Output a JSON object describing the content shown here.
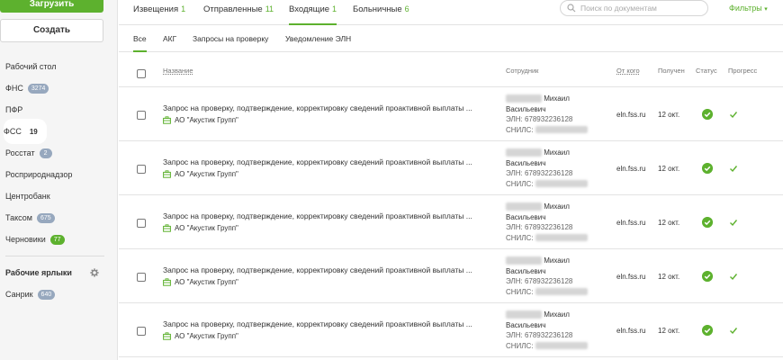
{
  "sidebar": {
    "upload_label": "Загрузить",
    "create_label": "Создать",
    "items": [
      {
        "label": "Рабочий стол",
        "badge": ""
      },
      {
        "label": "ФНС",
        "badge": "3274"
      },
      {
        "label": "ПФР",
        "badge": ""
      },
      {
        "label": "ФСС",
        "badge": "19"
      },
      {
        "label": "Росстат",
        "badge": "2"
      },
      {
        "label": "Росприроднадзор",
        "badge": ""
      },
      {
        "label": "Центробанк",
        "badge": ""
      },
      {
        "label": "Таксом",
        "badge": "675"
      },
      {
        "label": "Черновики",
        "badge": "77"
      }
    ],
    "labels_title": "Рабочие ярлыки",
    "labels": [
      {
        "label": "Санрик",
        "badge": "640"
      }
    ]
  },
  "topbar": {
    "tabs": [
      {
        "label": "Извещения",
        "count": "1"
      },
      {
        "label": "Отправленные",
        "count": "11"
      },
      {
        "label": "Входящие",
        "count": "1"
      },
      {
        "label": "Больничные",
        "count": "6"
      }
    ],
    "search_placeholder": "Поиск по документам",
    "filters_label": "Фильтры"
  },
  "subtabs": [
    "Все",
    "АКГ",
    "Запросы на проверку",
    "Уведомление ЭЛН"
  ],
  "table": {
    "headers": {
      "name": "Название",
      "employee": "Сотрудник",
      "from": "От кого",
      "received": "Получен",
      "status": "Статус",
      "progress": "Прогресс"
    },
    "rows": [
      {
        "title": "Запрос на проверку, подтверждение, корректировку сведений проактивной выплаты ...",
        "org": "АО \"Акустик Групп\"",
        "emp_name": "Михаил",
        "emp_patronymic": "Васильевич",
        "eln": "ЭЛН: 678932236128",
        "snils": "СНИЛС:",
        "from": "eln.fss.ru",
        "date": "12 окт."
      },
      {
        "title": "Запрос на проверку, подтверждение, корректировку сведений проактивной выплаты ...",
        "org": "АО \"Акустик Групп\"",
        "emp_name": "Михаил",
        "emp_patronymic": "Васильевич",
        "eln": "ЭЛН: 678932236128",
        "snils": "СНИЛС:",
        "from": "eln.fss.ru",
        "date": "12 окт."
      },
      {
        "title": "Запрос на проверку, подтверждение, корректировку сведений проактивной выплаты ...",
        "org": "АО \"Акустик Групп\"",
        "emp_name": "Михаил",
        "emp_patronymic": "Васильевич",
        "eln": "ЭЛН: 678932236128",
        "snils": "СНИЛС:",
        "from": "eln.fss.ru",
        "date": "12 окт."
      },
      {
        "title": "Запрос на проверку, подтверждение, корректировку сведений проактивной выплаты ...",
        "org": "АО \"Акустик Групп\"",
        "emp_name": "Михаил",
        "emp_patronymic": "Васильевич",
        "eln": "ЭЛН: 678932236128",
        "snils": "СНИЛС:",
        "from": "eln.fss.ru",
        "date": "12 окт."
      },
      {
        "title": "Запрос на проверку, подтверждение, корректировку сведений проактивной выплаты ...",
        "org": "АО \"Акустик Групп\"",
        "emp_name": "Михаил",
        "emp_patronymic": "Васильевич",
        "eln": "ЭЛН: 678932236128",
        "snils": "СНИЛС:",
        "from": "eln.fss.ru",
        "date": "12 окт."
      }
    ]
  },
  "colors": {
    "accent": "#5db12e",
    "badge_gray": "#97a8be"
  }
}
